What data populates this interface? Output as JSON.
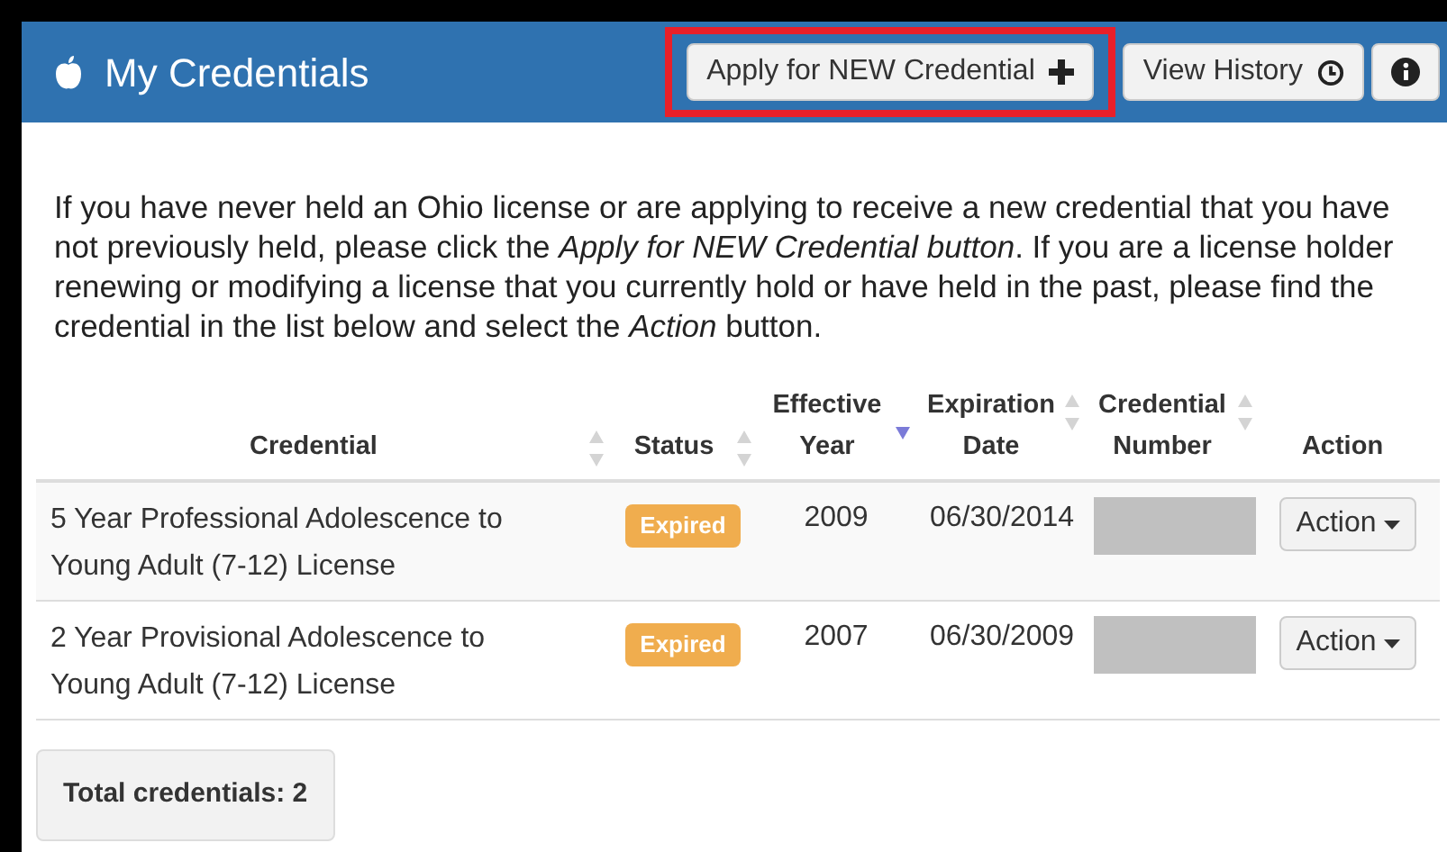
{
  "header": {
    "title": "My Credentials",
    "buttons": [
      {
        "kind": "apply",
        "label": "Apply for NEW Credential",
        "highlighted": true
      },
      {
        "kind": "history",
        "label": "View History",
        "highlighted": false
      },
      {
        "kind": "info",
        "highlighted": false
      }
    ]
  },
  "intro": "If you have never held an Ohio license or are applying to receive a new credential that you have not previously held, please click the *Apply for NEW Credential button*. If you are a license holder renewing or modifying a license that you currently hold or have held in the past, please find the credential in the list below and select the *Action* button.",
  "table": {
    "columns": [
      {
        "label": "Credential",
        "sortable": true,
        "sorted": false
      },
      {
        "label": "Status",
        "sortable": true,
        "sorted": false
      },
      {
        "label": "Effective Year",
        "sortable": true,
        "sorted": true
      },
      {
        "label": "Expiration Date",
        "sortable": true,
        "sorted": false
      },
      {
        "label": "Credential Number",
        "sortable": true,
        "sorted": false
      },
      {
        "label": "Action",
        "sortable": false,
        "sorted": false
      }
    ],
    "rows": [
      {
        "credential": "5 Year Professional Adolescence to Young Adult (7-12) License",
        "status": "Expired",
        "effective_year": "2009",
        "expiration_date": "06/30/2014",
        "number_redacted": true,
        "action": "Action"
      },
      {
        "credential": "2 Year Provisional Adolescence to Young Adult (7-12) License",
        "status": "Expired",
        "effective_year": "2007",
        "expiration_date": "06/30/2009",
        "number_redacted": true,
        "action": "Action"
      }
    ]
  },
  "total": "Total credentials: 2"
}
